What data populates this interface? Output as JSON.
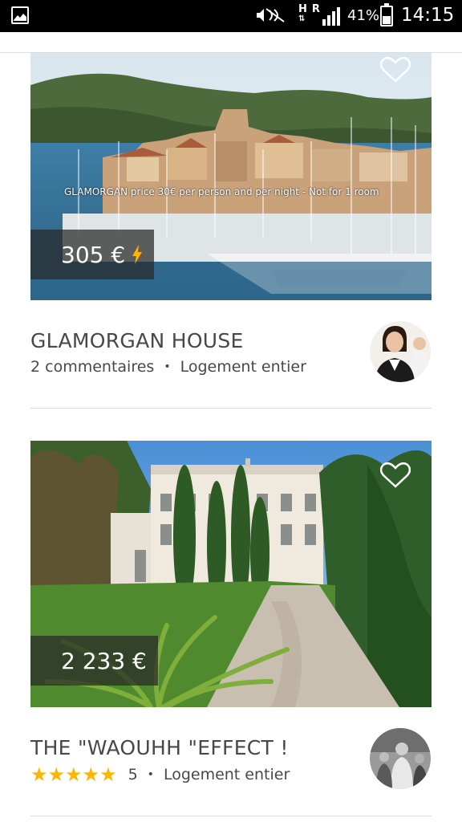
{
  "status_bar": {
    "network": "H R",
    "battery_percent": "41%",
    "time": "14:15"
  },
  "listings": [
    {
      "price": "305 €",
      "instant_book": true,
      "photo_caption": "GLAMORGAN price 30€ per person and per night - Not for 1 room",
      "title": "GLAMORGAN HOUSE",
      "reviews": "2 commentaires",
      "room_type": "Logement entier",
      "rating_stars": 0,
      "favorited": false
    },
    {
      "price": "2 233 €",
      "instant_book": false,
      "title": "THE \"WAOUHH \"EFFECT !",
      "rating_stars": 5,
      "reviews": "5",
      "room_type": "Logement entier",
      "favorited": false
    }
  ],
  "icons": {
    "notification": "image-icon",
    "mute": "mute-icon",
    "signal": "signal-icon",
    "battery": "battery-icon",
    "heart": "heart-icon",
    "instant_book": "lightning-icon",
    "star": "star-icon"
  },
  "colors": {
    "star": "#ffb400",
    "bolt": "#ffb400",
    "text": "#484848"
  }
}
